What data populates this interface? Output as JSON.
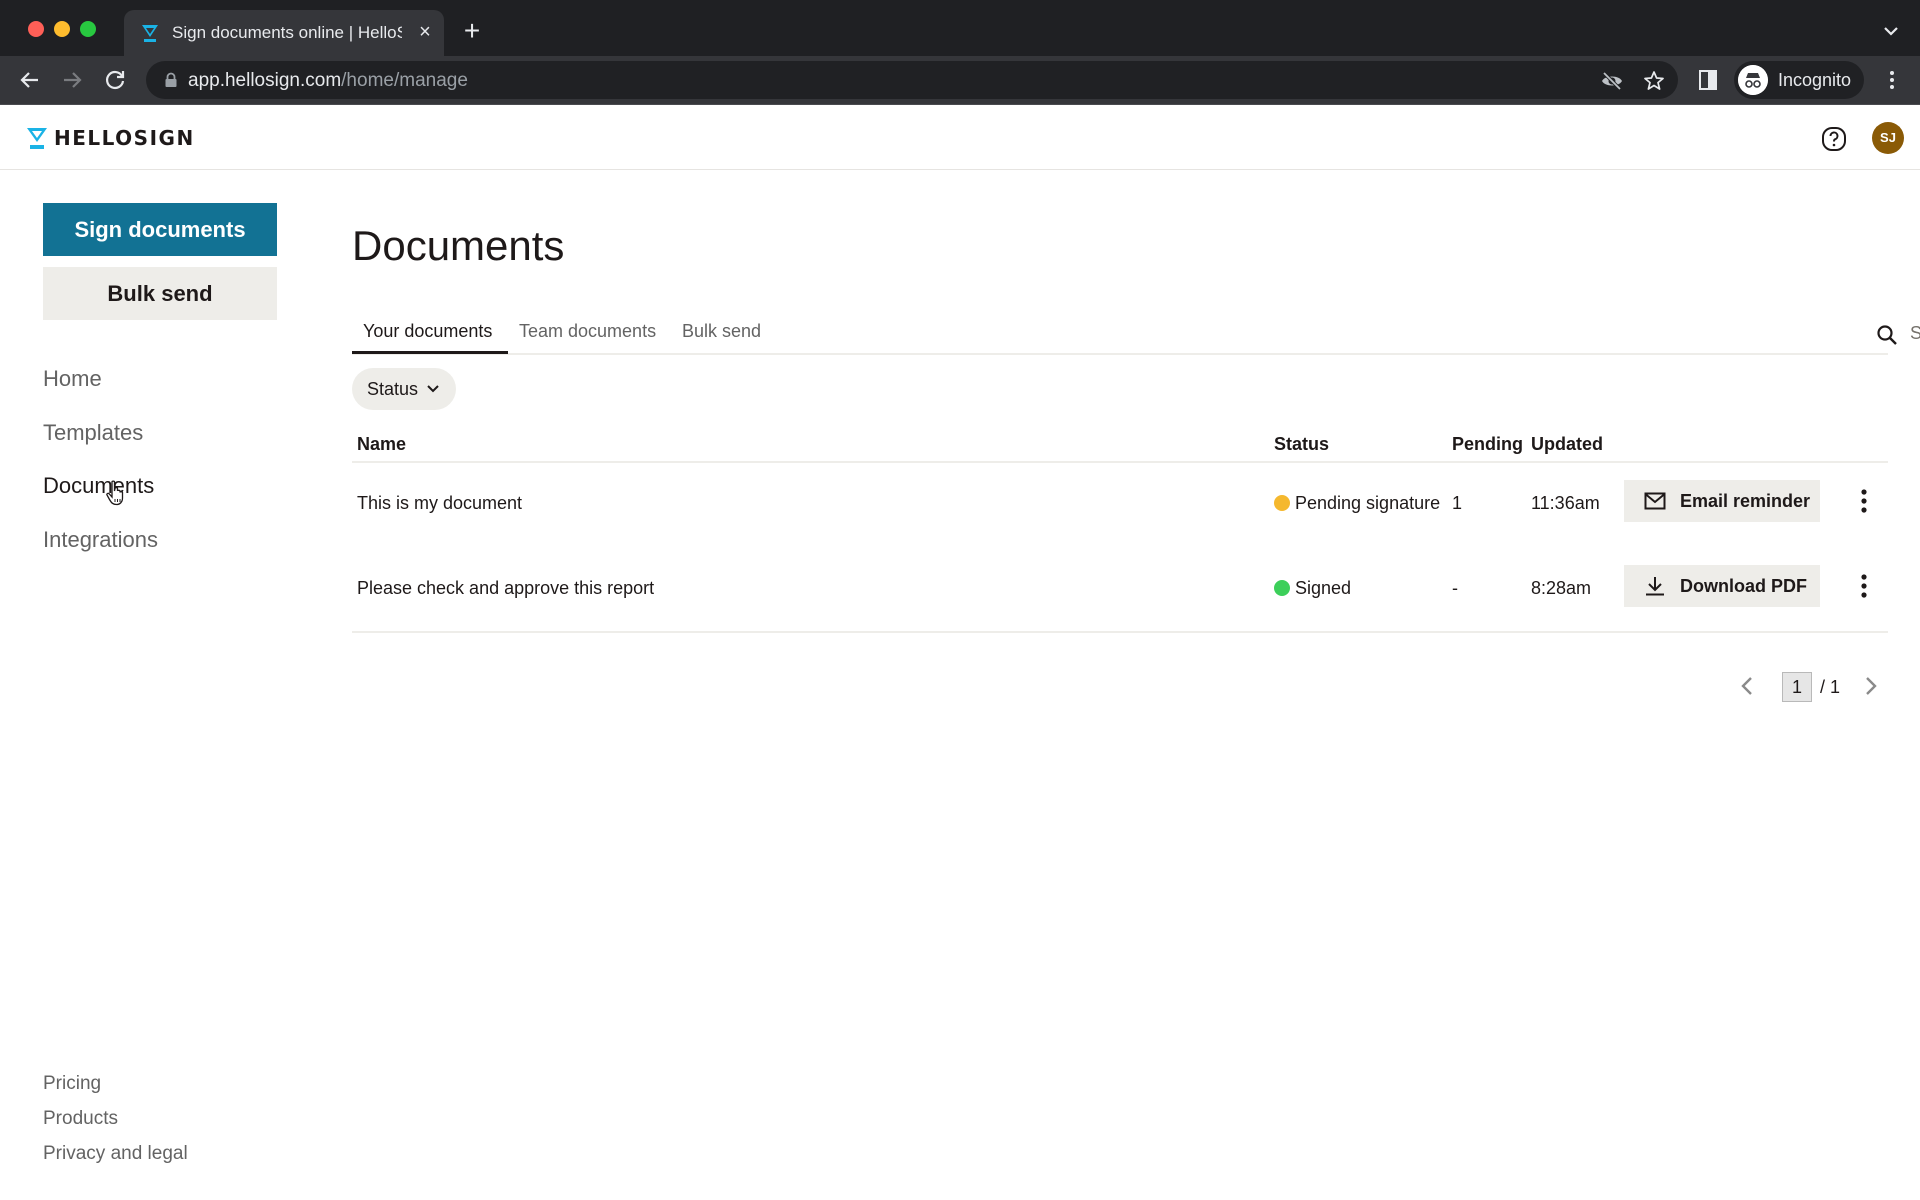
{
  "browser": {
    "tab_title": "Sign documents online | HelloS",
    "url_host": "app.hellosign.com",
    "url_path": "/home/manage",
    "profile_label": "Incognito"
  },
  "header": {
    "logo_text": "HELLOSIGN",
    "avatar_initials": "SJ",
    "brand_color": "#127294",
    "avatar_color": "#8a5a06"
  },
  "sidebar": {
    "primary_button": "Sign documents",
    "secondary_button": "Bulk send",
    "nav": [
      {
        "label": "Home",
        "active": false
      },
      {
        "label": "Templates",
        "active": false
      },
      {
        "label": "Documents",
        "active": true
      },
      {
        "label": "Integrations",
        "active": false
      }
    ],
    "footer": [
      {
        "label": "Pricing"
      },
      {
        "label": "Products"
      },
      {
        "label": "Privacy and legal"
      }
    ]
  },
  "main": {
    "title": "Documents",
    "tabs": [
      {
        "label": "Your documents",
        "active": true
      },
      {
        "label": "Team documents",
        "active": false
      },
      {
        "label": "Bulk send",
        "active": false
      }
    ],
    "search": {
      "placeholder": "Search by name, email or keyword",
      "value": ""
    },
    "filter": {
      "label": "Status"
    },
    "table": {
      "columns": [
        "Name",
        "Status",
        "Pending",
        "Updated"
      ],
      "rows": [
        {
          "name": "This is my document",
          "status": "Pending signature",
          "status_color": "#f5b82e",
          "pending": "1",
          "updated": "11:36am",
          "action": "Email reminder",
          "action_icon": "envelope-icon"
        },
        {
          "name": "Please check and approve this report",
          "status": "Signed",
          "status_color": "#3ccf5a",
          "pending": "-",
          "updated": "8:28am",
          "action": "Download PDF",
          "action_icon": "download-icon"
        }
      ]
    },
    "pagination": {
      "current": "1",
      "total": "/ 1"
    }
  }
}
